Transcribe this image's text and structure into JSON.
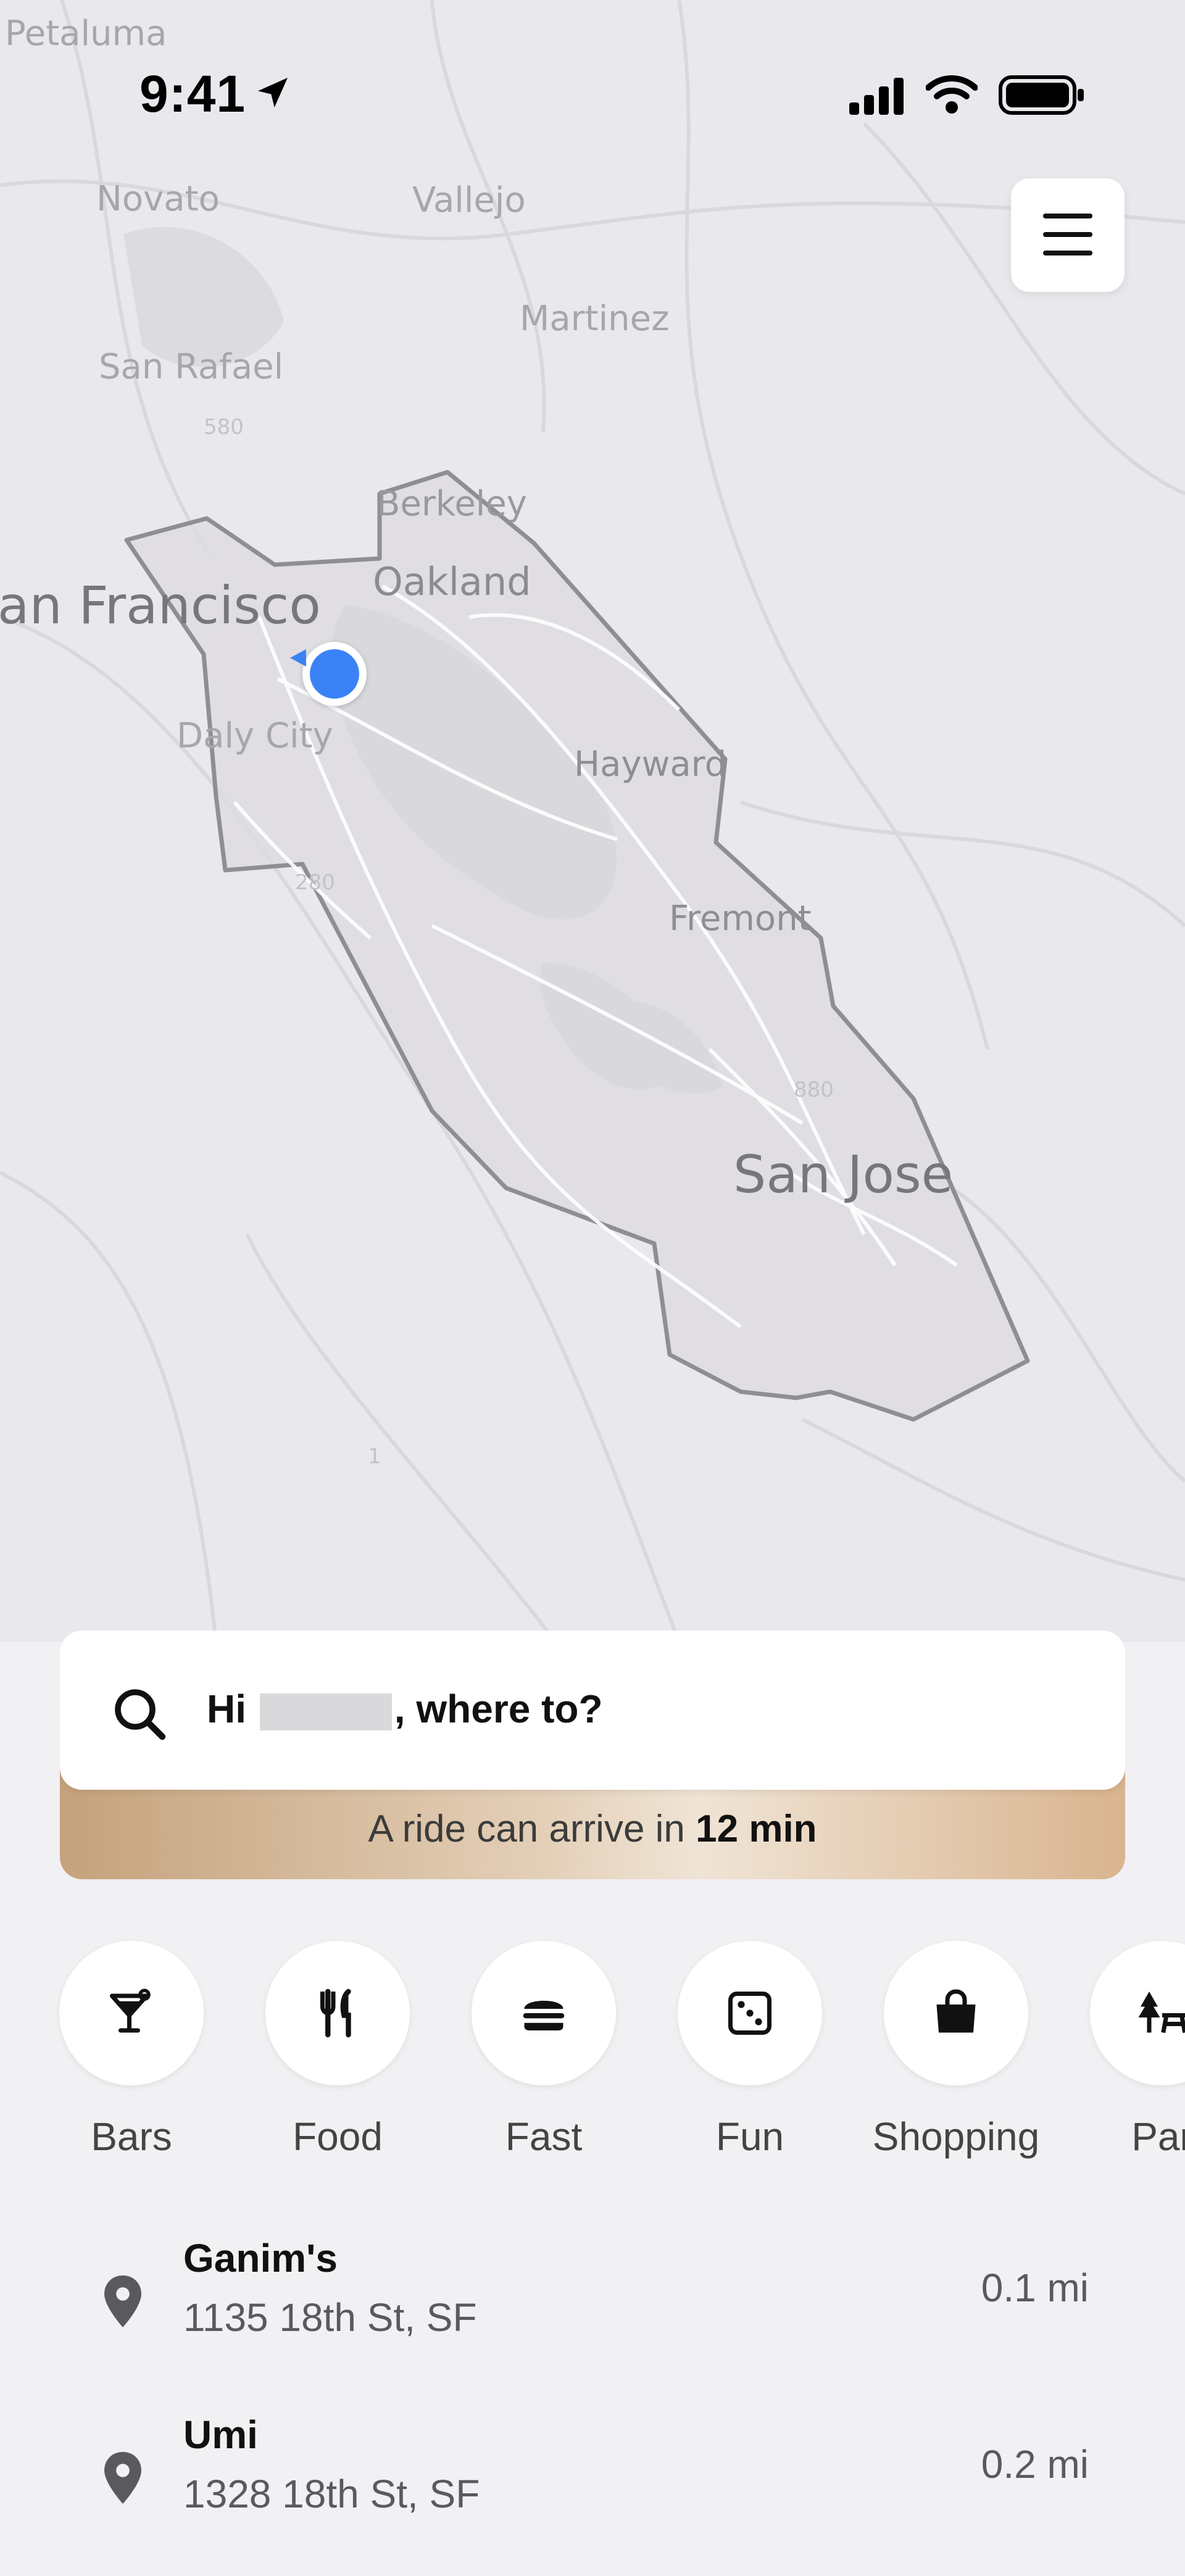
{
  "status_bar": {
    "time": "9:41"
  },
  "map": {
    "cities": {
      "petaluma": "Petaluma",
      "novato": "Novato",
      "vallejo": "Vallejo",
      "martinez": "Martinez",
      "san_rafael": "San Rafael",
      "berkeley": "Berkeley",
      "oakland": "Oakland",
      "san_francisco": "an Francisco",
      "daly_city": "Daly City",
      "hayward": "Hayward",
      "fremont": "Fremont",
      "san_jose": "San Jose"
    },
    "highways": {
      "h580": "580",
      "h880": "880",
      "h280": "280",
      "h1": "1"
    },
    "current_location_color": "#3b82f6"
  },
  "search": {
    "greeting_prefix": "Hi",
    "greeting_suffix": ", where to?",
    "eta_prefix": "A ride can arrive in",
    "eta_value": "12 min"
  },
  "categories": [
    {
      "label": "Bars",
      "icon": "cocktail-icon"
    },
    {
      "label": "Food",
      "icon": "fork-knife-icon"
    },
    {
      "label": "Fast",
      "icon": "burger-icon"
    },
    {
      "label": "Fun",
      "icon": "dice-icon"
    },
    {
      "label": "Shopping",
      "icon": "shopping-bag-icon"
    },
    {
      "label": "Par",
      "icon": "park-icon"
    }
  ],
  "places": [
    {
      "name": "Ganim's",
      "address": "1135 18th St, SF",
      "distance": "0.1 mi"
    },
    {
      "name": "Umi",
      "address": "1328 18th St, SF",
      "distance": "0.2 mi"
    }
  ]
}
